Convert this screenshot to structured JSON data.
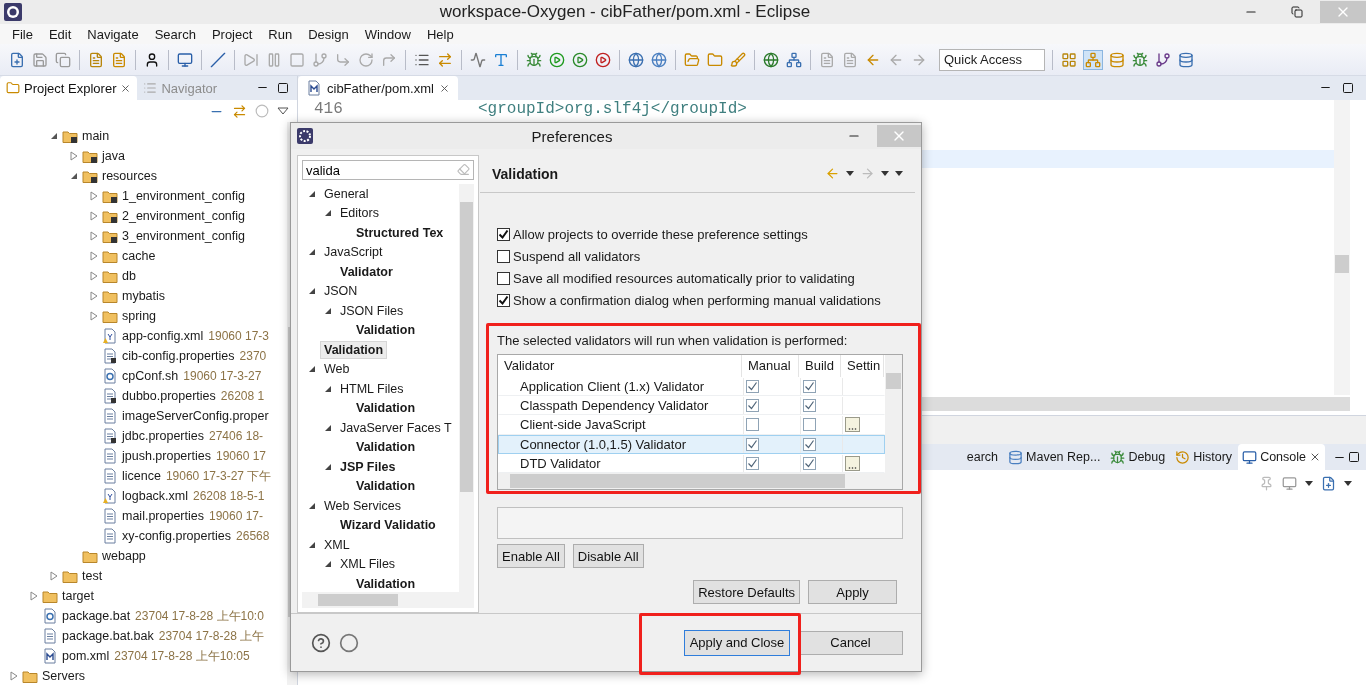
{
  "window": {
    "title": "workspace-Oxygen - cibFather/pom.xml - Eclipse"
  },
  "menu": [
    "File",
    "Edit",
    "Navigate",
    "Search",
    "Project",
    "Run",
    "Design",
    "Window",
    "Help"
  ],
  "quick_access": {
    "placeholder": "Quick Access"
  },
  "explorer": {
    "tabs": [
      {
        "label": "Project Explorer",
        "selected": true
      },
      {
        "label": "Navigator",
        "selected": false
      }
    ],
    "tree": [
      {
        "children": [
          {
            "children": [
              {
                "label": "main",
                "kind": "package-folder",
                "expanded": true,
                "children": [
                  {
                    "label": "java",
                    "kind": "package-folder",
                    "expanded": false
                  },
                  {
                    "label": "resources",
                    "kind": "package-folder",
                    "expanded": true,
                    "children": [
                      {
                        "label": "1_environment_config",
                        "kind": "package-folder",
                        "expanded": false
                      },
                      {
                        "label": "2_environment_config",
                        "kind": "package-folder",
                        "expanded": false
                      },
                      {
                        "label": "3_environment_config",
                        "kind": "package-folder",
                        "expanded": false
                      },
                      {
                        "label": "cache",
                        "kind": "folder",
                        "expanded": false
                      },
                      {
                        "label": "db",
                        "kind": "folder",
                        "expanded": false
                      },
                      {
                        "label": "mybatis",
                        "kind": "folder",
                        "expanded": false
                      },
                      {
                        "label": "spring",
                        "kind": "folder",
                        "expanded": false
                      },
                      {
                        "label": "app-config.xml",
                        "detail": "19060 17-3",
                        "kind": "xml"
                      },
                      {
                        "label": "cib-config.properties",
                        "detail": "2370",
                        "kind": "file-pkg"
                      },
                      {
                        "label": "cpConf.sh",
                        "detail": "19060 17-3-27",
                        "kind": "script"
                      },
                      {
                        "label": "dubbo.properties",
                        "detail": "26208 1",
                        "kind": "file-pkg"
                      },
                      {
                        "label": "imageServerConfig.proper",
                        "kind": "file"
                      },
                      {
                        "label": "jdbc.properties",
                        "detail": "27406 18-",
                        "kind": "file-pkg"
                      },
                      {
                        "label": "jpush.properties",
                        "detail": "19060 17",
                        "kind": "file"
                      },
                      {
                        "label": "licence",
                        "detail": "19060 17-3-27 下午",
                        "kind": "file"
                      },
                      {
                        "label": "logback.xml",
                        "detail": "26208 18-5-1",
                        "kind": "xml"
                      },
                      {
                        "label": "mail.properties",
                        "detail": "19060 17-",
                        "kind": "file"
                      },
                      {
                        "label": "xy-config.properties",
                        "detail": "26568",
                        "kind": "file"
                      }
                    ]
                  },
                  {
                    "label": "webapp",
                    "kind": "folder"
                  }
                ]
              },
              {
                "label": "test",
                "kind": "folder",
                "expanded": false
              }
            ]
          },
          {
            "label": "target",
            "kind": "folder",
            "expanded": false
          },
          {
            "label": "package.bat",
            "detail": "23704 17-8-28 上午10:0",
            "kind": "script"
          },
          {
            "label": "package.bat.bak",
            "detail": "23704 17-8-28 上午",
            "kind": "file"
          },
          {
            "label": "pom.xml",
            "detail": "23704 17-8-28 上午10:05",
            "kind": "maven"
          }
        ]
      },
      {
        "label": "Servers",
        "kind": "folder",
        "expanded": false
      }
    ]
  },
  "editor": {
    "tab": "cibFather/pom.xml",
    "lines": [
      {
        "number": "416",
        "code": "<groupId>org.slf4j</groupId>"
      }
    ]
  },
  "bottom_panel": {
    "tabs": [
      {
        "label": "earch",
        "selected": false,
        "kind": "plain"
      },
      {
        "label": "Maven Rep...",
        "selected": false,
        "kind": "repository"
      },
      {
        "label": "Debug",
        "selected": false,
        "kind": "debug"
      },
      {
        "label": "History",
        "selected": false,
        "kind": "history"
      },
      {
        "label": "Console",
        "selected": true,
        "kind": "console"
      }
    ]
  },
  "dialog": {
    "title": "Preferences",
    "filter": {
      "value": "valida"
    },
    "tree": [
      {
        "label": "General",
        "match": false,
        "selected": false,
        "expanded": true,
        "children": [
          {
            "label": "Editors",
            "match": false,
            "selected": false,
            "expanded": true,
            "children": [
              {
                "label": "Structured Tex",
                "match": true,
                "selected": false
              }
            ]
          }
        ]
      },
      {
        "label": "JavaScript",
        "match": false,
        "selected": false,
        "expanded": true,
        "children": [
          {
            "label": "Validator",
            "match": true,
            "selected": false
          }
        ]
      },
      {
        "label": "JSON",
        "match": false,
        "selected": false,
        "expanded": true,
        "children": [
          {
            "label": "JSON Files",
            "match": false,
            "selected": false,
            "expanded": true,
            "children": [
              {
                "label": "Validation",
                "match": true,
                "selected": false
              }
            ]
          }
        ]
      },
      {
        "label": "Validation",
        "match": true,
        "selected": true
      },
      {
        "label": "Web",
        "match": false,
        "selected": false,
        "expanded": true,
        "children": [
          {
            "label": "HTML Files",
            "match": false,
            "selected": false,
            "expanded": true,
            "children": [
              {
                "label": "Validation",
                "match": true,
                "selected": false
              }
            ]
          },
          {
            "label": "JavaServer Faces T",
            "match": false,
            "selected": false,
            "expanded": true,
            "children": [
              {
                "label": "Validation",
                "match": true,
                "selected": false
              }
            ]
          },
          {
            "label": "JSP Files",
            "match": true,
            "selected": false,
            "expanded": true,
            "children": [
              {
                "label": "Validation",
                "match": true,
                "selected": false
              }
            ]
          }
        ]
      },
      {
        "label": "Web Services",
        "match": false,
        "selected": false,
        "expanded": true,
        "children": [
          {
            "label": "Wizard Validatio",
            "match": true,
            "selected": false
          }
        ]
      },
      {
        "label": "XML",
        "match": false,
        "selected": false,
        "expanded": true,
        "children": [
          {
            "label": "XML Files",
            "match": false,
            "selected": false,
            "expanded": true,
            "children": [
              {
                "label": "Validation",
                "match": true,
                "selected": false
              }
            ]
          }
        ]
      }
    ],
    "page_title": "Validation",
    "options": [
      {
        "label": "Allow projects to override these preference settings",
        "checked": true
      },
      {
        "label": "Suspend all validators",
        "checked": false
      },
      {
        "label": "Save all modified resources automatically prior to validating",
        "checked": false
      },
      {
        "label": "Show a confirmation dialog when performing manual validations",
        "checked": true
      }
    ],
    "group_label": "The selected validators will run when validation is performed:",
    "table": {
      "columns": [
        "Validator",
        "Manual",
        "Build",
        "Settin"
      ],
      "rows": [
        {
          "name": "Application Client (1.x) Validator",
          "manual": true,
          "build": true,
          "settings": false,
          "selected": false
        },
        {
          "name": "Classpath Dependency Validator",
          "manual": true,
          "build": true,
          "settings": false,
          "selected": false
        },
        {
          "name": "Client-side JavaScript",
          "manual": false,
          "build": false,
          "settings": true,
          "selected": false
        },
        {
          "name": "Connector (1.0,1.5) Validator",
          "manual": true,
          "build": true,
          "settings": false,
          "selected": true
        },
        {
          "name": "DTD Validator",
          "manual": true,
          "build": true,
          "settings": true,
          "selected": false
        }
      ]
    },
    "buttons": [
      {
        "label": "Enable All",
        "kind": "left"
      },
      {
        "label": "Disable All",
        "kind": "left"
      },
      {
        "label": "Restore Defaults",
        "kind": "page"
      },
      {
        "label": "Apply",
        "kind": "page"
      },
      {
        "label": "Apply and Close",
        "kind": "default"
      },
      {
        "label": "Cancel",
        "kind": "footer"
      }
    ]
  }
}
